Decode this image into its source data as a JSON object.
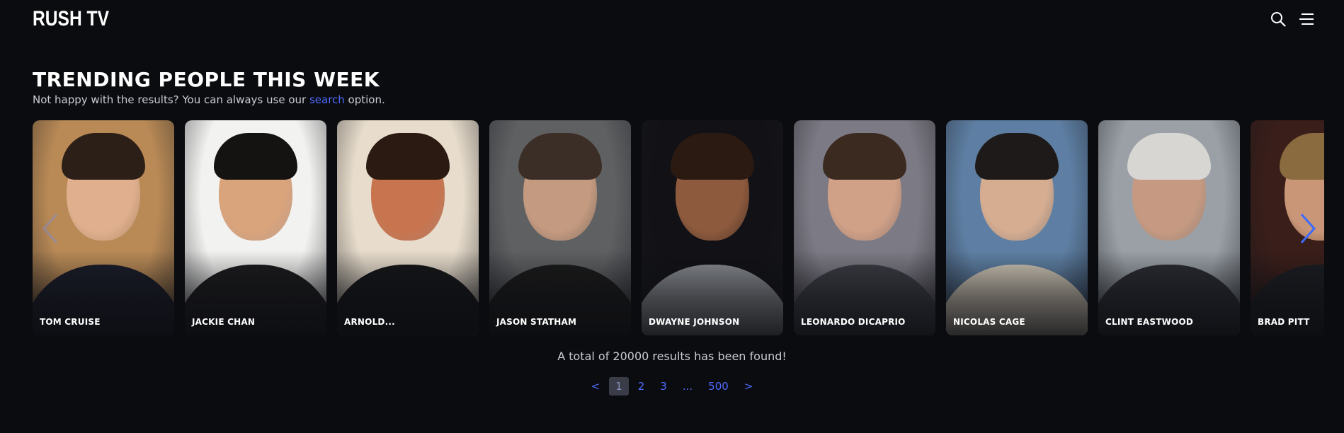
{
  "header": {
    "logo": "RUSH TV",
    "icons": [
      "search-icon",
      "menu-icon"
    ]
  },
  "section": {
    "title": "TRENDING PEOPLE THIS WEEK",
    "subtitle_before": "Not happy with the results? You can always use our ",
    "subtitle_link": "search",
    "subtitle_after": " option."
  },
  "people": [
    {
      "name": "TOM CRUISE",
      "bg": "#b98a56",
      "skin": "#e0b08e",
      "hair": "#2c1f17",
      "shirt": "#1a1c28"
    },
    {
      "name": "JACKIE CHAN",
      "bg": "#f2f2f0",
      "skin": "#d9a37c",
      "hair": "#151212",
      "shirt": "#1b1b1d"
    },
    {
      "name": "ARNOLD...",
      "bg": "#e8ddcc",
      "skin": "#c8744f",
      "hair": "#2a1a12",
      "shirt": "#141618"
    },
    {
      "name": "JASON STATHAM",
      "bg": "#5e6062",
      "skin": "#c49a80",
      "hair": "#3b2e27",
      "shirt": "#1a1a1a"
    },
    {
      "name": "DWAYNE JOHNSON",
      "bg": "#121216",
      "skin": "#8d5a3d",
      "hair": "#2a1a12",
      "shirt": "#8a8d92"
    },
    {
      "name": "LEONARDO DICAPRIO",
      "bg": "#7c7a84",
      "skin": "#d0a087",
      "hair": "#3a2a1f",
      "shirt": "#3b3d44"
    },
    {
      "name": "NICOLAS CAGE",
      "bg": "#5e7fa3",
      "skin": "#d6ad91",
      "hair": "#1d1a19",
      "shirt": "#cfc6b6"
    },
    {
      "name": "CLINT EASTWOOD",
      "bg": "#9aa0a6",
      "skin": "#c69a82",
      "hair": "#d8d6d2",
      "shirt": "#2a2c32"
    },
    {
      "name": "BRAD PITT",
      "bg": "#3a1e1a",
      "skin": "#c99677",
      "hair": "#8a6a3f",
      "shirt": "#1c1d22"
    }
  ],
  "carousel": {
    "prev_icon": "chevron-left-icon",
    "next_icon": "chevron-right-icon"
  },
  "results_text": "A total of 20000 results has been found!",
  "pagination": {
    "prev": "<",
    "pages": [
      "1",
      "2",
      "3"
    ],
    "ellipsis": "...",
    "last": "500",
    "next": ">",
    "current": "1"
  },
  "colors": {
    "background": "#0b0c10",
    "accent": "#4f6bff",
    "text_muted": "#c9ccd4"
  }
}
